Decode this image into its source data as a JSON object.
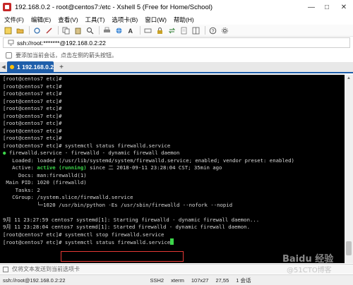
{
  "window": {
    "title": "192.168.0.2 - root@centos7:/etc - Xshell 5 (Free for Home/School)",
    "minimize": "—",
    "maximize": "□",
    "close": "✕"
  },
  "menu": {
    "items": [
      "文件(F)",
      "编辑(E)",
      "查看(V)",
      "工具(T)",
      "选项卡(B)",
      "窗口(W)",
      "帮助(H)"
    ]
  },
  "address": {
    "value": "ssh://root:*******@192.168.0.2:22"
  },
  "hint": {
    "text": "要添加当前会话，点击左侧的箭头按钮。"
  },
  "tabs": {
    "active_label": "1 192.168.0.2",
    "add_label": "+"
  },
  "terminal": {
    "lines": [
      "[root@centos7 etc]#",
      "[root@centos7 etc]#",
      "[root@centos7 etc]#",
      "[root@centos7 etc]#",
      "[root@centos7 etc]#",
      "[root@centos7 etc]#",
      "[root@centos7 etc]#",
      "[root@centos7 etc]#",
      "[root@centos7 etc]#",
      "[root@centos7 etc]# systemctl status firewalld.service",
      "firewalld.service - firewalld - dynamic firewall daemon",
      "   Loaded: loaded (/usr/lib/systemd/system/firewalld.service; enabled; vendor preset: enabled)",
      "   Active: ",
      "     Docs: man:firewalld(1)",
      " Main PID: 1020 (firewalld)",
      "    Tasks: 2",
      "   CGroup: /system.slice/firewalld.service",
      "           └─1020 /usr/bin/python -Es /usr/sbin/firewalld --nofork --nopid",
      "",
      "9月 11 23:27:59 centos7 systemd[1]: Starting firewalld - dynamic firewall daemon...",
      "9月 11 23:28:04 centos7 systemd[1]: Started firewalld - dynamic firewall daemon.",
      "[root@centos7 etc]# systemctl stop firewalld.service",
      "[root@centos7 etc]# systemctl status firewalld.service"
    ],
    "bullet": "●",
    "active_state": "active (running)",
    "active_since": " since 二 2018-09-11 23:28:04 CST; 35min ago"
  },
  "input_bar": {
    "text": "仅将文本发送到当前选项卡"
  },
  "status": {
    "path": "ssh://root@192.168.0.2:22",
    "protocol": "SSH2",
    "terminal_type": "xterm",
    "size": "107x27",
    "position": "27,55",
    "sessions": "1 会话"
  },
  "watermark": {
    "logo": "Baidu 经验",
    "sub": "@51CTO博客"
  }
}
